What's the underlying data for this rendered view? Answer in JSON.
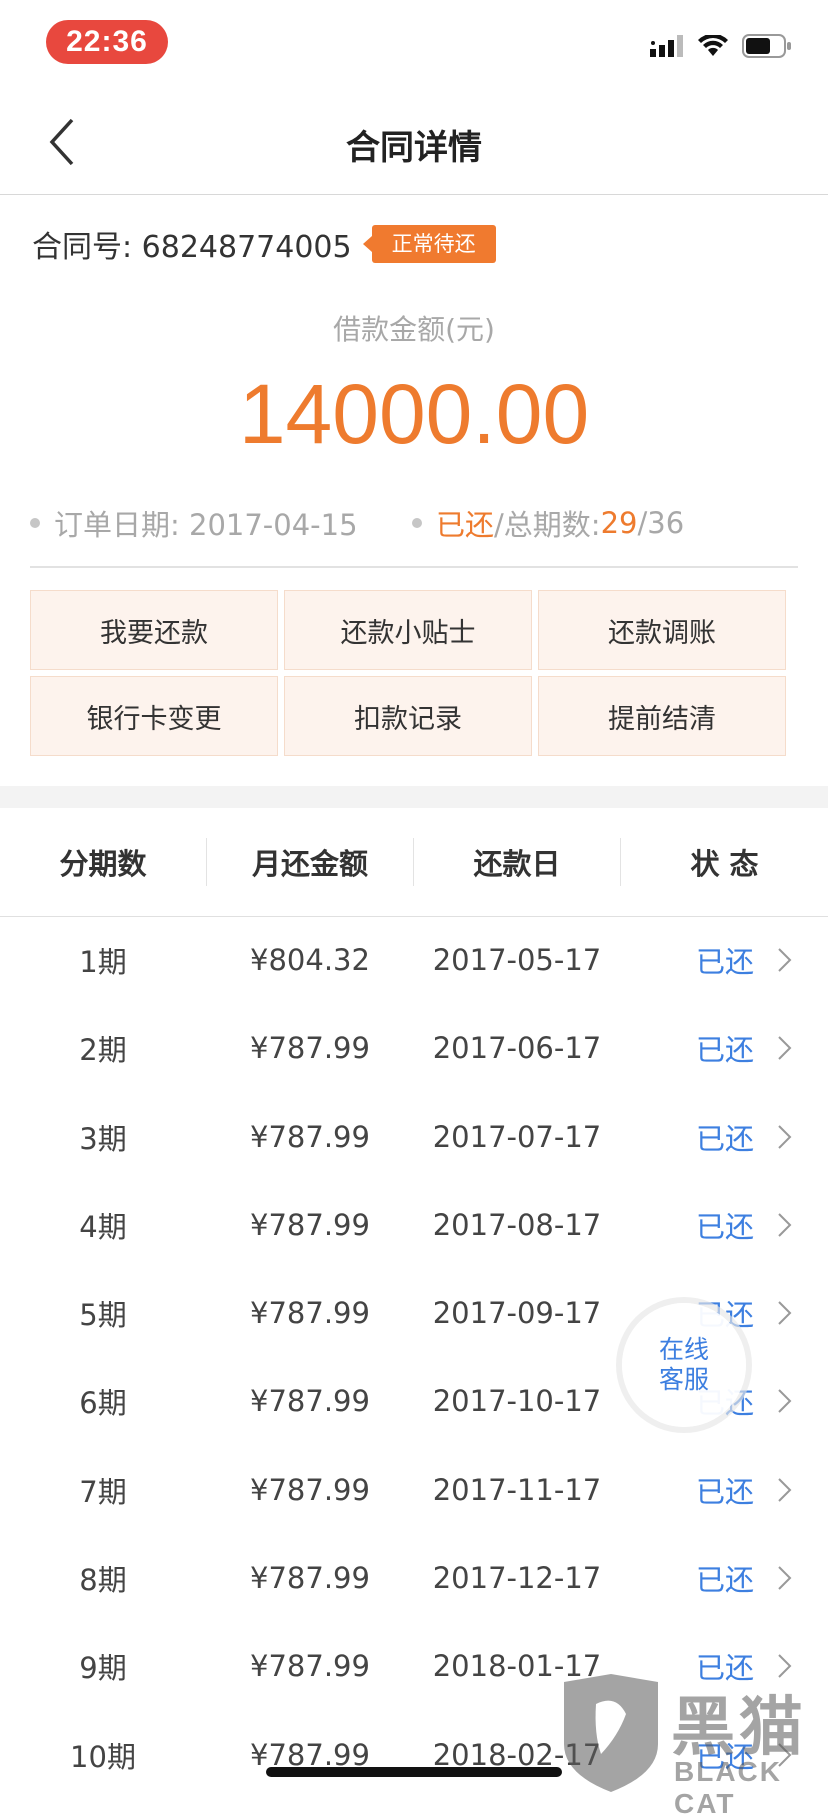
{
  "status_bar": {
    "time": "22:36",
    "icons": [
      "signal-icon",
      "wifi-icon",
      "battery-icon"
    ]
  },
  "nav": {
    "title": "合同详情",
    "back_icon": "chevron-left-icon"
  },
  "contract": {
    "label": "合同号: 68248774005",
    "status_badge": "正常待还",
    "amount_label": "借款金额(元)",
    "amount": "14000.00",
    "order_date_label": "订单日期: 2017-04-15",
    "paid_label": "已还",
    "total_label": "/总期数: ",
    "paid_count": "29",
    "total_count": "/36"
  },
  "actions": [
    {
      "label": "我要还款"
    },
    {
      "label": "还款小贴士"
    },
    {
      "label": "还款调账"
    },
    {
      "label": "银行卡变更"
    },
    {
      "label": "扣款记录"
    },
    {
      "label": "提前结清"
    }
  ],
  "table": {
    "headers": [
      "分期数",
      "月还金额",
      "还款日",
      "状 态"
    ],
    "rows": [
      {
        "period": "1期",
        "amount": "¥804.32",
        "date": "2017-05-17",
        "status": "已还"
      },
      {
        "period": "2期",
        "amount": "¥787.99",
        "date": "2017-06-17",
        "status": "已还"
      },
      {
        "period": "3期",
        "amount": "¥787.99",
        "date": "2017-07-17",
        "status": "已还"
      },
      {
        "period": "4期",
        "amount": "¥787.99",
        "date": "2017-08-17",
        "status": "已还"
      },
      {
        "period": "5期",
        "amount": "¥787.99",
        "date": "2017-09-17",
        "status": "已还"
      },
      {
        "period": "6期",
        "amount": "¥787.99",
        "date": "2017-10-17",
        "status": "已还"
      },
      {
        "period": "7期",
        "amount": "¥787.99",
        "date": "2017-11-17",
        "status": "已还"
      },
      {
        "period": "8期",
        "amount": "¥787.99",
        "date": "2017-12-17",
        "status": "已还"
      },
      {
        "period": "9期",
        "amount": "¥787.99",
        "date": "2018-01-17",
        "status": "已还"
      },
      {
        "period": "10期",
        "amount": "¥787.99",
        "date": "2018-02-17",
        "status": "已还"
      }
    ]
  },
  "service_float": {
    "line1": "在线",
    "line2": "客服"
  },
  "watermark": {
    "text": "黑猫",
    "sub": "BLACK CAT"
  },
  "colors": {
    "accent_orange": "#ee7b2e",
    "status_blue": "#3d7fe0",
    "time_pill": "#e8483e"
  }
}
